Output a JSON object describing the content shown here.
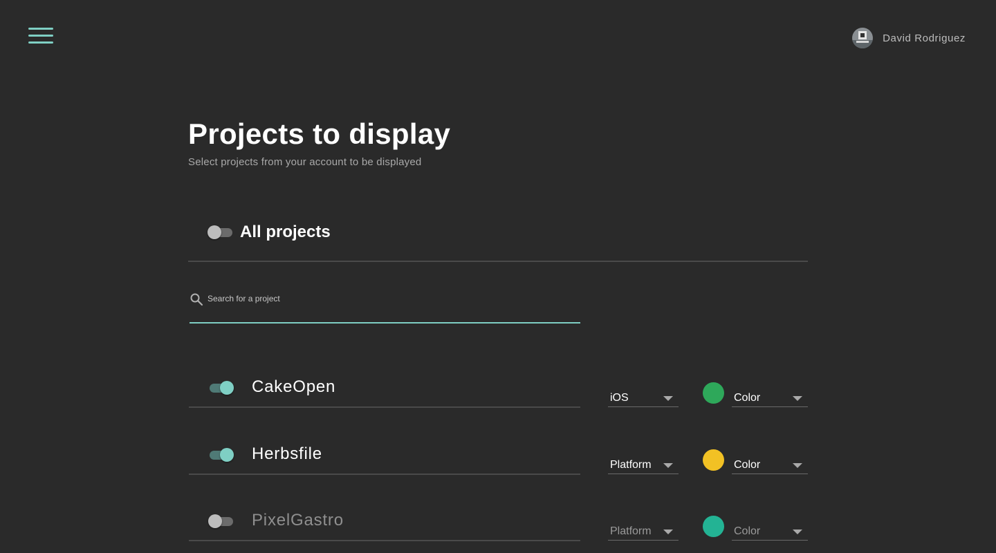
{
  "header": {
    "menu_icon": "hamburger-menu-icon",
    "user_name": "David Rodriguez"
  },
  "main": {
    "title": "Projects to display",
    "subtitle": "Select projects from your account to be displayed",
    "all_projects": {
      "label": "All projects",
      "enabled": false
    },
    "search": {
      "placeholder": "Search for a project",
      "value": "",
      "icon": "search-icon"
    },
    "projects": [
      {
        "name": "CakeOpen",
        "enabled": true,
        "platform": "iOS",
        "color_label": "Color",
        "color": "#2ea85a"
      },
      {
        "name": "Herbsfile",
        "enabled": true,
        "platform": "Platform",
        "color_label": "Color",
        "color": "#f2c124"
      },
      {
        "name": "PixelGastro",
        "enabled": false,
        "platform": "Platform",
        "color_label": "Color",
        "color": "#23b394"
      }
    ]
  },
  "colors": {
    "background": "#2a2a2a",
    "accent": "#7fcfc4",
    "divider": "#4a4a4a"
  }
}
